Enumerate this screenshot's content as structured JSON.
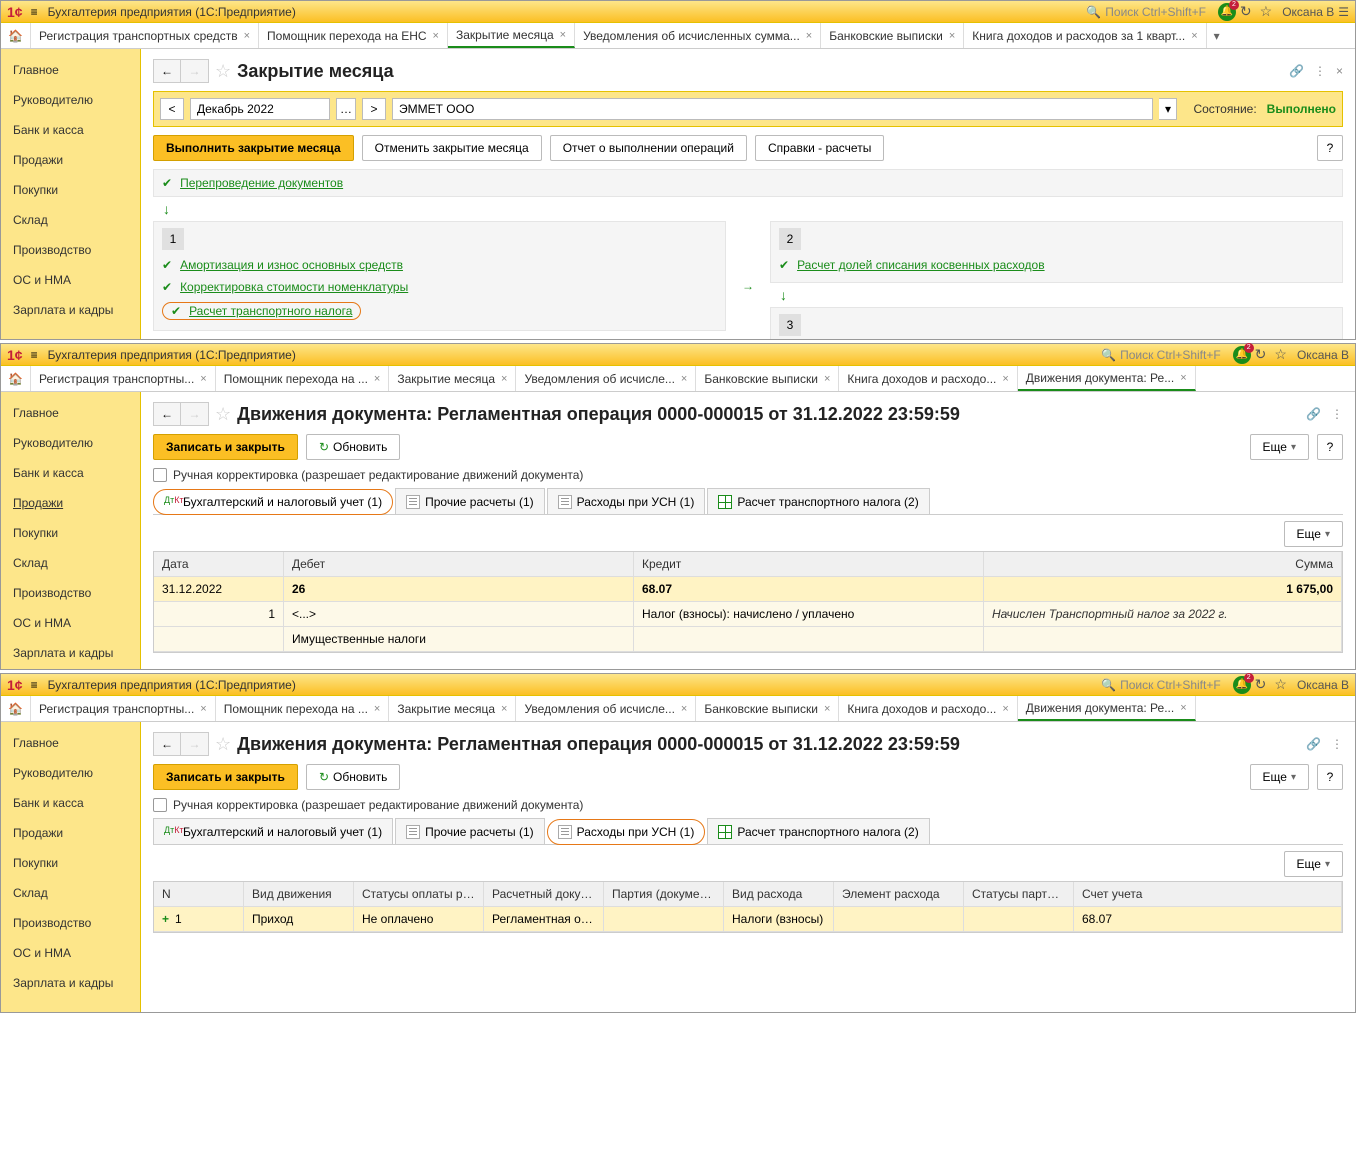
{
  "titlebar": {
    "product": "Бухгалтерия предприятия  (1С:Предприятие)",
    "search": "Поиск Ctrl+Shift+F",
    "user": "Оксана В"
  },
  "win1": {
    "tabs": [
      "Регистрация транспортных средств",
      "Помощник перехода на ЕНС",
      "Закрытие месяца",
      "Уведомления об исчисленных сумма...",
      "Банковские выписки",
      "Книга доходов и расходов за 1 кварт..."
    ],
    "active_tab": 2,
    "sidebar": [
      "Главное",
      "Руководителю",
      "Банк и касса",
      "Продажи",
      "Покупки",
      "Склад",
      "Производство",
      "ОС и НМА",
      "Зарплата и кадры"
    ],
    "page_title": "Закрытие месяца",
    "period": "Декабрь 2022",
    "org": "ЭММЕТ ООО",
    "state_label": "Состояние:",
    "state_value": "Выполнено",
    "buttons": {
      "run": "Выполнить закрытие месяца",
      "cancel": "Отменить закрытие месяца",
      "report": "Отчет о выполнении операций",
      "spravki": "Справки - расчеты",
      "help": "?"
    },
    "top_step": "Перепроведение документов",
    "col1_items": [
      "Амортизация и износ основных средств",
      "Корректировка стоимости номенклатуры",
      "Расчет транспортного налога"
    ],
    "col2_item": "Расчет долей списания косвенных расходов"
  },
  "win2": {
    "tabs": [
      "Регистрация транспортны...",
      "Помощник перехода на ...",
      "Закрытие месяца",
      "Уведомления об исчисле...",
      "Банковские выписки",
      "Книга доходов и расходо...",
      "Движения документа: Ре..."
    ],
    "active_tab": 6,
    "sidebar": [
      "Главное",
      "Руководителю",
      "Банк и касса",
      "Продажи",
      "Покупки",
      "Склад",
      "Производство",
      "ОС и НМА",
      "Зарплата и кадры"
    ],
    "sidebar_active": 3,
    "page_title": "Движения документа: Регламентная операция 0000-000015 от 31.12.2022 23:59:59",
    "buttons": {
      "save": "Записать и закрыть",
      "refresh": "Обновить",
      "more": "Еще",
      "help": "?"
    },
    "manual": "Ручная корректировка (разрешает редактирование движений документа)",
    "subtabs": [
      "Бухгалтерский и налоговый учет (1)",
      "Прочие расчеты (1)",
      "Расходы при УСН (1)",
      "Расчет транспортного налога (2)"
    ],
    "active_subtab": 0,
    "headers": {
      "date": "Дата",
      "debet": "Дебет",
      "kredit": "Кредит",
      "sum": "Сумма"
    },
    "row": {
      "date": "31.12.2022",
      "debet": "26",
      "kredit": "68.07",
      "sum": "1 675,00"
    },
    "row2": {
      "n": "1",
      "sub": "<...>",
      "desc": "Налог (взносы): начислено / уплачено",
      "note": "Начислен Транспортный налог за 2022 г."
    },
    "row3": "Имущественные налоги"
  },
  "win3": {
    "tabs": [
      "Регистрация транспортны...",
      "Помощник перехода на ...",
      "Закрытие месяца",
      "Уведомления об исчисле...",
      "Банковские выписки",
      "Книга доходов и расходо...",
      "Движения документа: Ре..."
    ],
    "active_tab": 6,
    "sidebar": [
      "Главное",
      "Руководителю",
      "Банк и касса",
      "Продажи",
      "Покупки",
      "Склад",
      "Производство",
      "ОС и НМА",
      "Зарплата и кадры"
    ],
    "page_title": "Движения документа: Регламентная операция 0000-000015 от 31.12.2022 23:59:59",
    "buttons": {
      "save": "Записать и закрыть",
      "refresh": "Обновить",
      "more": "Еще",
      "help": "?"
    },
    "manual": "Ручная корректировка (разрешает редактирование движений документа)",
    "subtabs": [
      "Бухгалтерский и налоговый учет (1)",
      "Прочие расчеты (1)",
      "Расходы при УСН (1)",
      "Расчет транспортного налога (2)"
    ],
    "active_subtab": 2,
    "headers": {
      "n": "N",
      "mov": "Вид движения",
      "stat": "Статусы оплаты рас...",
      "doc": "Расчетный документ",
      "party": "Партия (документ ...",
      "exp": "Вид расхода",
      "elem": "Элемент расхода",
      "pstat": "Статусы партий ...",
      "acct": "Счет учета"
    },
    "row": {
      "n": "1",
      "mov": "Приход",
      "stat": "Не оплачено",
      "doc": "Регламентная опе...",
      "party": "",
      "exp": "Налоги (взносы)",
      "elem": "",
      "pstat": "",
      "acct": "68.07"
    }
  }
}
